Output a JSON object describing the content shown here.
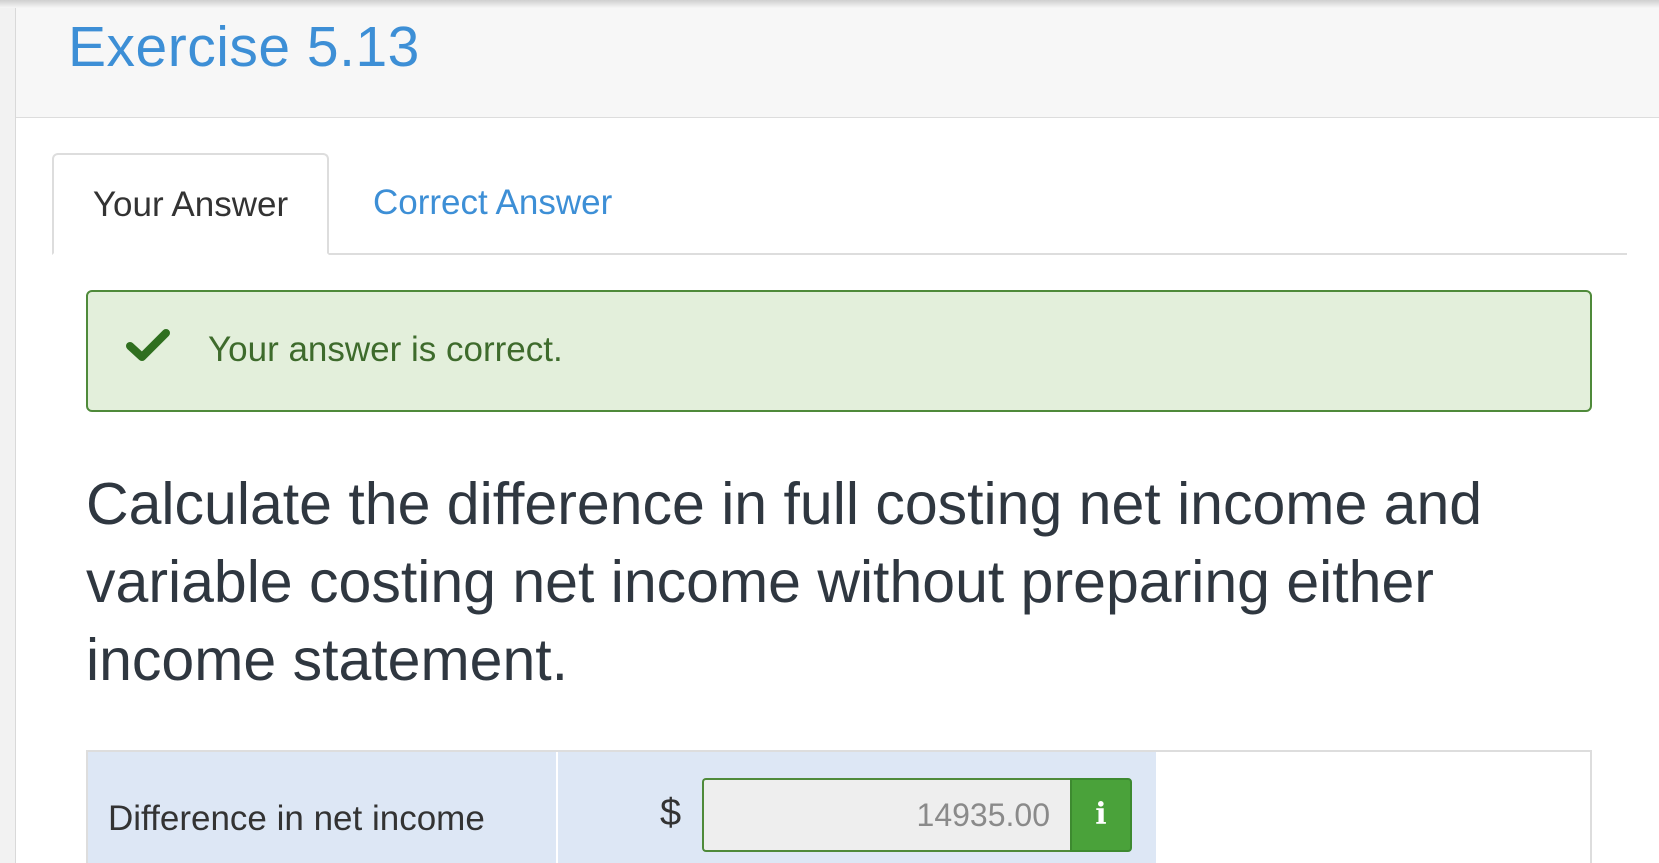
{
  "header": {
    "title": "Exercise 5.13"
  },
  "tabs": [
    {
      "label": "Your Answer",
      "active": true
    },
    {
      "label": "Correct Answer",
      "active": false
    }
  ],
  "alert": {
    "icon": "check-icon",
    "message": "Your answer is correct.",
    "color": "#4f8a3a"
  },
  "question": {
    "text": "Calculate the difference in full costing net income and variable costing net income without preparing either income statement."
  },
  "answer_row": {
    "label": "Difference in net income",
    "currency": "$",
    "value": "14935.00",
    "info_button": "i",
    "info_icon": "info-icon"
  },
  "colors": {
    "accent": "#3d8fd6",
    "success": "#4aa23a",
    "success_bg": "#e3efdb"
  }
}
